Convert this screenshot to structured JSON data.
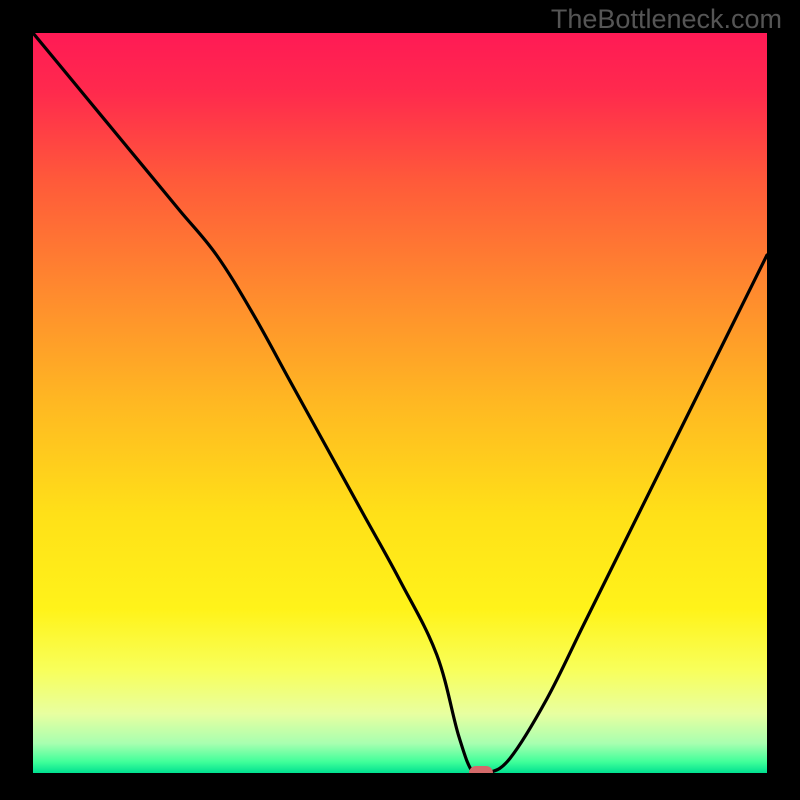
{
  "watermark": "TheBottleneck.com",
  "chart_data": {
    "type": "line",
    "title": "",
    "xlabel": "",
    "ylabel": "",
    "xlim": [
      0,
      100
    ],
    "ylim": [
      0,
      100
    ],
    "x": [
      0,
      5,
      10,
      15,
      20,
      25,
      30,
      35,
      40,
      45,
      50,
      55,
      58,
      60,
      62,
      65,
      70,
      75,
      80,
      85,
      90,
      95,
      100
    ],
    "values": [
      100,
      94,
      88,
      82,
      76,
      70,
      62,
      53,
      44,
      35,
      26,
      16,
      5,
      0,
      0,
      2,
      10,
      20,
      30,
      40,
      50,
      60,
      70
    ],
    "marker_x": 61,
    "marker_y": 0,
    "background_gradient": {
      "stops": [
        {
          "offset": 0.0,
          "color": "#ff1a55"
        },
        {
          "offset": 0.08,
          "color": "#ff2a4d"
        },
        {
          "offset": 0.2,
          "color": "#ff5a3a"
        },
        {
          "offset": 0.35,
          "color": "#ff8a2e"
        },
        {
          "offset": 0.5,
          "color": "#ffb822"
        },
        {
          "offset": 0.65,
          "color": "#ffe018"
        },
        {
          "offset": 0.78,
          "color": "#fff31a"
        },
        {
          "offset": 0.86,
          "color": "#f8ff5a"
        },
        {
          "offset": 0.92,
          "color": "#e8ffa0"
        },
        {
          "offset": 0.96,
          "color": "#a8ffb0"
        },
        {
          "offset": 0.985,
          "color": "#40ff9a"
        },
        {
          "offset": 1.0,
          "color": "#00e090"
        }
      ]
    },
    "marker_color": "#d46a6a",
    "line_color": "#000000"
  }
}
